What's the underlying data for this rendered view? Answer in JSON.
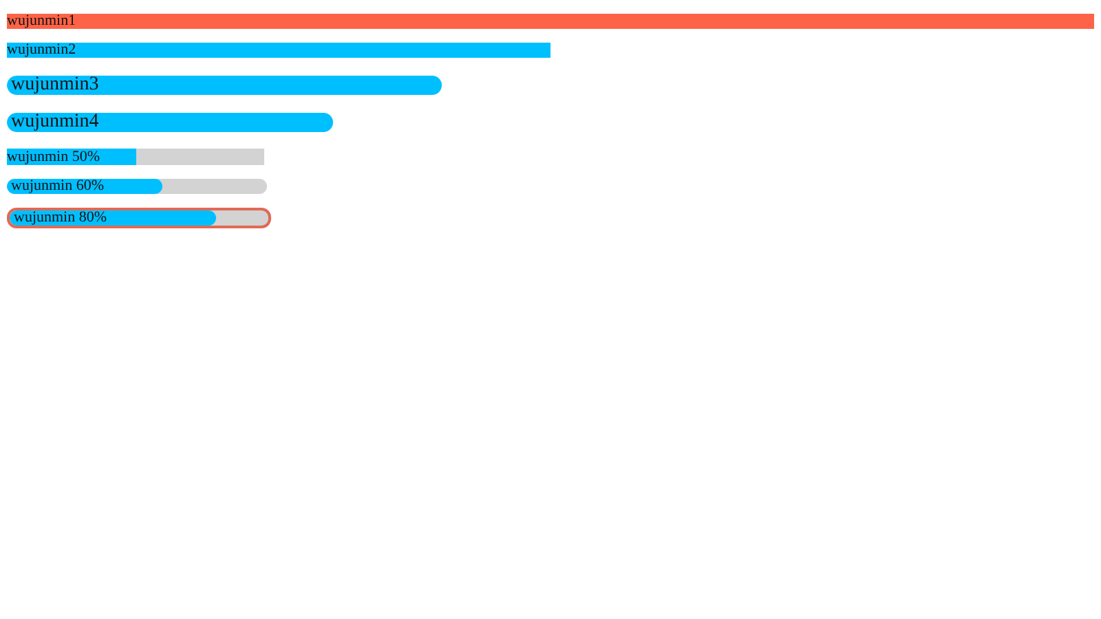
{
  "progress_bars": [
    {
      "kind": "flat",
      "label": "wujunmin1",
      "level": 1,
      "color": "#ff6347"
    },
    {
      "kind": "flat",
      "label": "wujunmin2",
      "level": 0.5,
      "color": "#00bfff"
    },
    {
      "kind": "pill",
      "label": "wujunmin3",
      "level": 0.4,
      "color": "#00bfff"
    },
    {
      "kind": "pill",
      "label": "wujunmin4",
      "level": 0.3,
      "color": "#00bfff"
    },
    {
      "kind": "track",
      "label": "wujunmin 50%",
      "level": 0.5,
      "color": "#00bfff"
    },
    {
      "kind": "rounded-track",
      "label": "wujunmin 60%",
      "level": 0.6,
      "color": "#00bfff"
    },
    {
      "kind": "outlined-track",
      "label": "wujunmin 80%",
      "level": 0.8,
      "color": "#00bfff"
    }
  ]
}
